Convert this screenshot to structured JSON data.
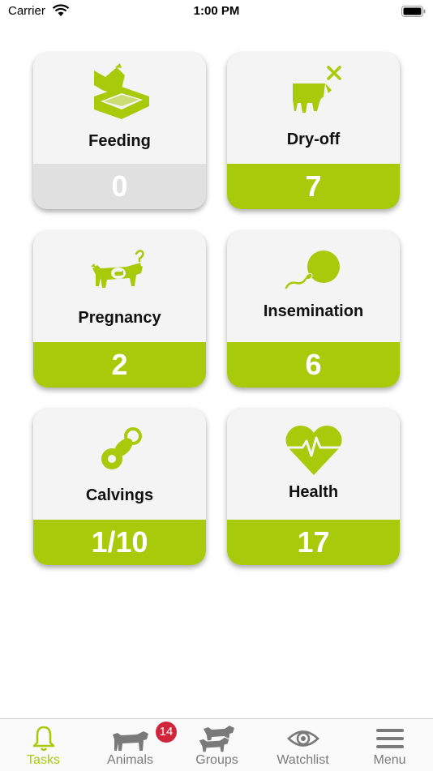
{
  "status_bar": {
    "carrier": "Carrier",
    "time": "1:00 PM"
  },
  "tiles": [
    {
      "label": "Feeding",
      "count": "0",
      "icon": "feeding-trough-icon"
    },
    {
      "label": "Dry-off",
      "count": "7",
      "icon": "udder-cross-icon"
    },
    {
      "label": "Pregnancy",
      "count": "2",
      "icon": "pregnant-cow-icon"
    },
    {
      "label": "Insemination",
      "count": "6",
      "icon": "sperm-egg-icon"
    },
    {
      "label": "Calvings",
      "count": "1/10",
      "icon": "pacifier-icon"
    },
    {
      "label": "Health",
      "count": "17",
      "icon": "heart-pulse-icon"
    }
  ],
  "tabbar": {
    "items": [
      {
        "label": "Tasks",
        "icon": "bell-icon",
        "active": true
      },
      {
        "label": "Animals",
        "icon": "cow-icon",
        "badge": "14"
      },
      {
        "label": "Groups",
        "icon": "cows-group-icon"
      },
      {
        "label": "Watchlist",
        "icon": "eye-icon"
      },
      {
        "label": "Menu",
        "icon": "hamburger-icon"
      }
    ]
  },
  "colors": {
    "accent": "#a9c90b",
    "badge": "#d0253a",
    "inactive_tab": "#7a7a7a"
  }
}
